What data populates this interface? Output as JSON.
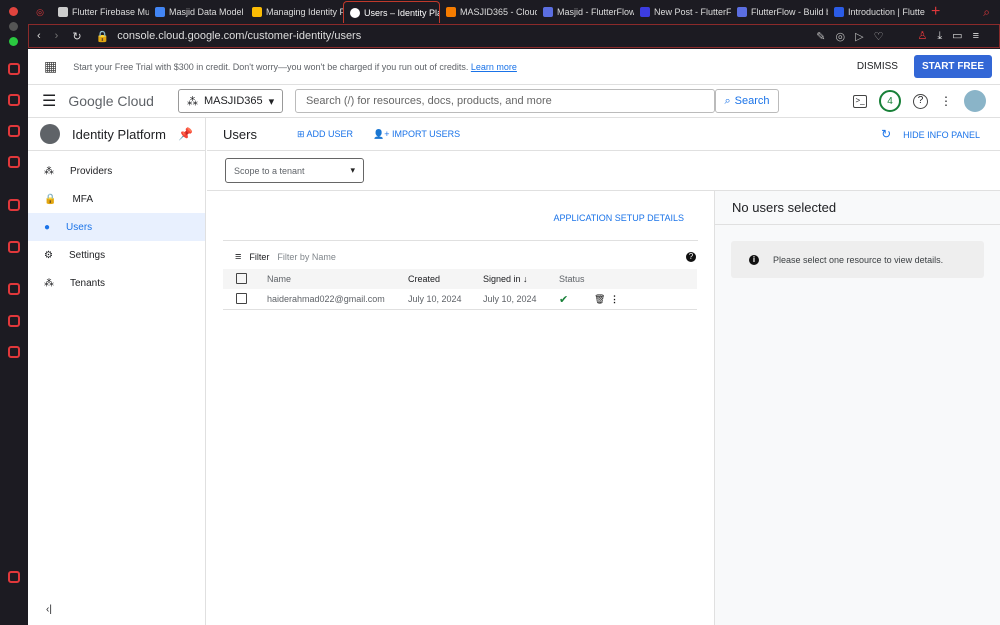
{
  "browser": {
    "tabs": [
      "Flutter Firebase Mult",
      "Masjid Data Model -",
      "Managing Identity P",
      "Users – Identity Platf",
      "MASJID365 - Cloud",
      "Masjid - FlutterFlow",
      "New Post - FlutterFl",
      "FlutterFlow - Build b",
      "Introduction | Flutter"
    ],
    "url": "console.cloud.google.com/customer-identity/users"
  },
  "banner": {
    "text": "Start your Free Trial with $300 in credit. Don't worry—you won't be charged if you run out of credits.",
    "learn_more": "Learn more",
    "dismiss": "DISMISS",
    "start_free": "START FREE"
  },
  "header": {
    "logo": "Google Cloud",
    "project": "MASJID365",
    "search_placeholder": "Search (/) for resources, docs, products, and more",
    "search_button": "Search",
    "notifications": "4"
  },
  "sidebar": {
    "title": "Identity Platform",
    "items": [
      {
        "label": "Providers"
      },
      {
        "label": "MFA"
      },
      {
        "label": "Users"
      },
      {
        "label": "Settings"
      },
      {
        "label": "Tenants"
      }
    ]
  },
  "toolbar": {
    "title": "Users",
    "add_user": "ADD USER",
    "import_users": "IMPORT USERS",
    "hide_info": "HIDE INFO PANEL"
  },
  "tenant_select": "Scope to a tenant",
  "app_setup": "APPLICATION SETUP DETAILS",
  "filter": {
    "label": "Filter",
    "placeholder": "Filter by Name"
  },
  "table": {
    "headers": [
      "Name",
      "Created",
      "Signed in",
      "Status"
    ],
    "rows": [
      {
        "name": "haiderahmad022@gmail.com",
        "created": "July 10, 2024",
        "signed_in": "July 10, 2024"
      }
    ]
  },
  "info_panel": {
    "title": "No users selected",
    "message": "Please select one resource to view details."
  }
}
